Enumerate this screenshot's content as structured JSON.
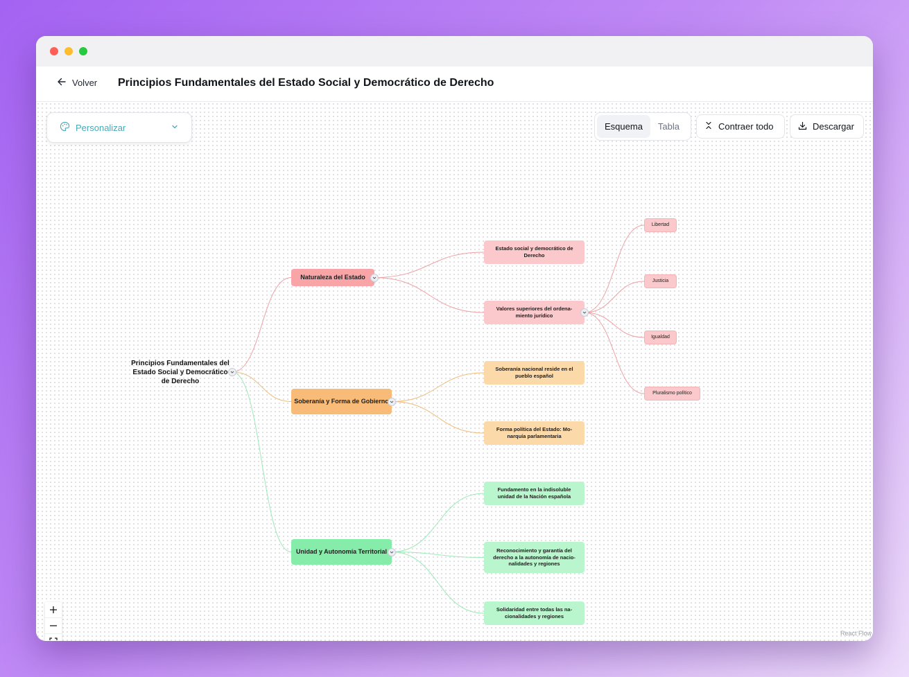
{
  "header": {
    "back_label": "Volver",
    "title": "Principios Fundamentales del Estado Social y Democrático de Derecho"
  },
  "toolbar": {
    "personalizar_label": "Personalizar",
    "view_tabs": [
      {
        "label": "Esquema",
        "active": true
      },
      {
        "label": "Tabla",
        "active": false
      }
    ],
    "collapse_label": "Contraer todo",
    "download_label": "Descargar"
  },
  "attribution": "React Flow",
  "colors": {
    "red_main": "#f9a5a8",
    "red_soft": "#fbc9cb",
    "orange_main": "#f8bc78",
    "orange_soft": "#fcd9a8",
    "green_main": "#86eca9",
    "green_soft": "#b9f6cd",
    "edge_red": "#eda2a4",
    "edge_orange": "#efbd7c",
    "edge_green": "#9de9b6",
    "accent": "#4aa8b4"
  },
  "mindmap": {
    "root": "Principios Fundamentales del Estado Social y Democrático de Derecho",
    "branches": [
      {
        "label": "Naturaleza del Estado",
        "children": [
          {
            "label": "Estado social y democrático de Derecho",
            "children": []
          },
          {
            "label": "Valores superiores del ordena-miento jurídico",
            "children": [
              "Libertad",
              "Justicia",
              "Igualdad",
              "Pluralismo político"
            ]
          }
        ]
      },
      {
        "label": "Soberanía y Forma de Gobierno",
        "children": [
          {
            "label": "Soberanía nacional reside en el pueblo español",
            "children": []
          },
          {
            "label": "Forma política del Estado: Mo-narquía parlamentaria",
            "children": []
          }
        ]
      },
      {
        "label": "Unidad y Autonomía Territorial",
        "children": [
          {
            "label": "Fundamento en la indisoluble unidad de la Nación española",
            "children": []
          },
          {
            "label": "Reconocimiento y garantía del derecho a la autonomía de nacio-nalidades y regiones",
            "children": []
          },
          {
            "label": "Solidaridad entre todas las na-cionalidades y regiones",
            "children": []
          }
        ]
      }
    ]
  }
}
